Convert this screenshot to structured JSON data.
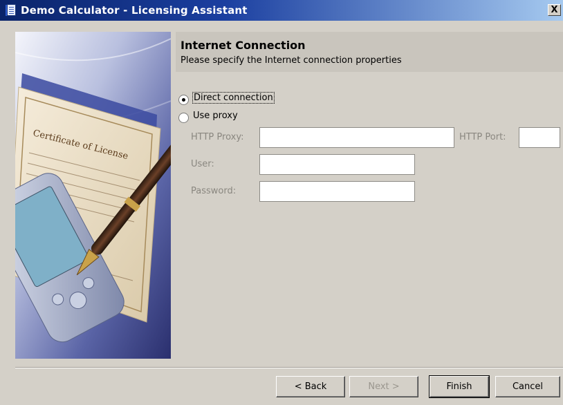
{
  "window": {
    "title": "Demo Calculator - Licensing Assistant",
    "close_label": "X"
  },
  "header": {
    "title": "Internet Connection",
    "subtitle": "Please specify the Internet connection properties"
  },
  "connection": {
    "direct_label": "Direct connection",
    "proxy_label": "Use proxy",
    "selected": "direct"
  },
  "proxy": {
    "http_proxy_label": "HTTP Proxy:",
    "http_proxy_value": "",
    "http_port_label": "HTTP Port:",
    "http_port_value": "",
    "user_label": "User:",
    "user_value": "",
    "password_label": "Password:",
    "password_value": ""
  },
  "buttons": {
    "back": "< Back",
    "next": "Next >",
    "finish": "Finish",
    "cancel": "Cancel"
  },
  "colors": {
    "titlebar_start": "#0a246a",
    "titlebar_end": "#a6caf0",
    "dialog_bg": "#d4d0c8",
    "disabled_text": "#8a8780"
  },
  "icons": {
    "app": "document-icon",
    "side_image": "certificate-pen-pda-illustration"
  }
}
